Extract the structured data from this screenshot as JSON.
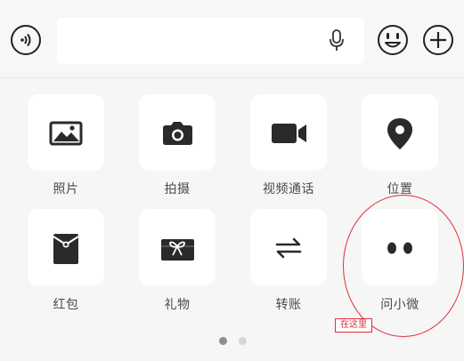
{
  "input_bar": {
    "text_value": "",
    "icons": {
      "voice": "voice-input-icon",
      "mic": "microphone-icon",
      "emoji": "emoji-icon",
      "more": "plus-icon"
    }
  },
  "panel": {
    "items": [
      {
        "label": "照片",
        "icon": "image-icon"
      },
      {
        "label": "拍摄",
        "icon": "camera-icon"
      },
      {
        "label": "视频通话",
        "icon": "video-camera-icon"
      },
      {
        "label": "位置",
        "icon": "location-pin-icon"
      },
      {
        "label": "红包",
        "icon": "red-envelope-icon"
      },
      {
        "label": "礼物",
        "icon": "gift-icon"
      },
      {
        "label": "转账",
        "icon": "transfer-arrows-icon"
      },
      {
        "label": "问小微",
        "icon": "two-dots-icon"
      }
    ],
    "page_indicator": {
      "pages": 2,
      "current": 1
    }
  },
  "annotation": {
    "label": "在这里",
    "color": "#e0303a"
  }
}
